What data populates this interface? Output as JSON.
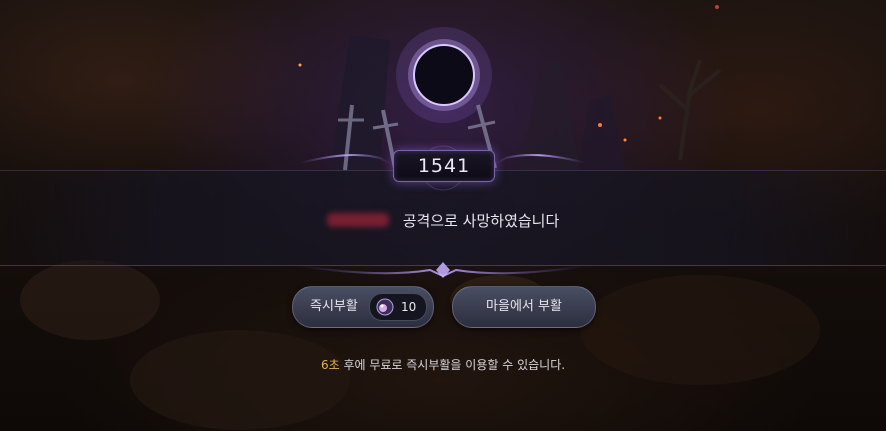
{
  "timer": {
    "value": "1541"
  },
  "death": {
    "message": "공격으로 사망하였습니다",
    "attacker_hidden": true
  },
  "buttons": {
    "instant_revive": {
      "label": "즉시부활",
      "cost": "10",
      "icon": "revive-gem-icon"
    },
    "town_revive": {
      "label": "마을에서 부활"
    }
  },
  "notice": {
    "seconds": "6초",
    "text": " 후에 무료로 즉시부활을 이용할 수 있습니다."
  },
  "colors": {
    "accent": "#e8b24a",
    "frame": "#7a64a8"
  }
}
